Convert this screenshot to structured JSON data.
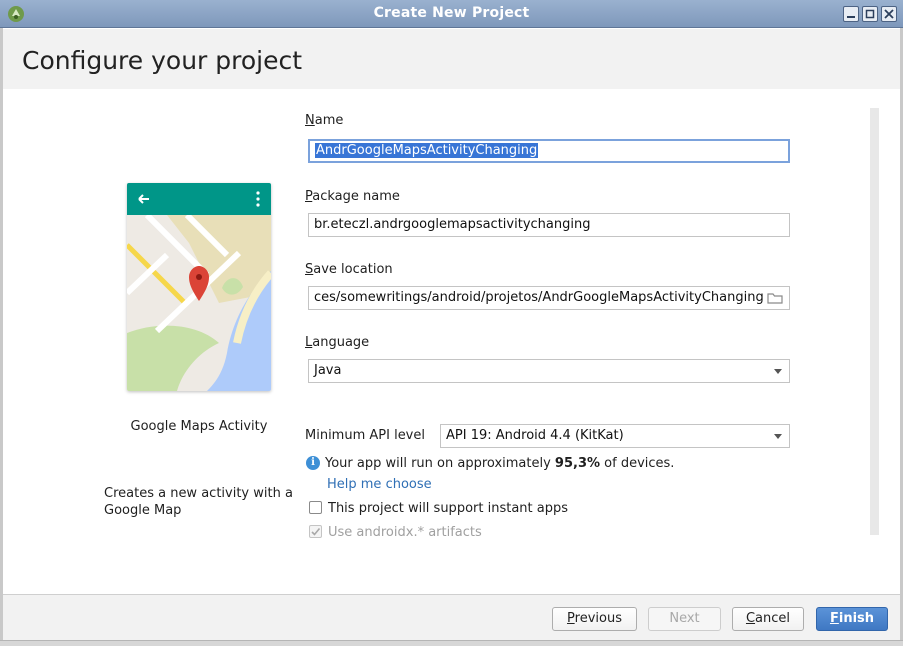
{
  "window": {
    "title": "Create New Project"
  },
  "header": {
    "title": "Configure your project"
  },
  "template": {
    "name": "Google Maps Activity",
    "description": "Creates a new activity with a Google Map"
  },
  "form": {
    "name": {
      "label": "Name",
      "mnemonic": "N",
      "rest": "ame",
      "value": "AndrGoogleMapsActivityChanging"
    },
    "package": {
      "label": "Package name",
      "mnemonic": "P",
      "rest": "ackage name",
      "value": "br.eteczl.andrgooglemapsactivitychanging"
    },
    "save_location": {
      "label": "Save location",
      "mnemonic": "S",
      "rest": "ave location",
      "value": "ces/somewritings/android/projetos/AndrGoogleMapsActivityChanging"
    },
    "language": {
      "label": "Language",
      "pre": "",
      "mnemonic": "L",
      "rest": "anguage",
      "value": "Java"
    },
    "min_api": {
      "label": "Minimum API level",
      "value": "API 19: Android 4.4 (KitKat)"
    },
    "info": {
      "pre": "Your app will run on approximately ",
      "percent": "95,3%",
      "post": " of devices."
    },
    "help_link": "Help me choose",
    "instant_apps": {
      "label": "This project will support instant apps",
      "checked": false
    },
    "androidx": {
      "label": "Use androidx.* artifacts",
      "checked": true,
      "disabled": true
    }
  },
  "footer": {
    "previous": {
      "mnemonic": "P",
      "rest": "revious"
    },
    "next": "Next",
    "cancel": {
      "mnemonic": "C",
      "rest": "ancel"
    },
    "finish": {
      "mnemonic": "F",
      "rest": "inish"
    }
  },
  "colors": {
    "titlebar": "#8ea6c7",
    "primary_button": "#4a84cc",
    "map_toolbar": "#009688",
    "link": "#2f6fb5"
  }
}
